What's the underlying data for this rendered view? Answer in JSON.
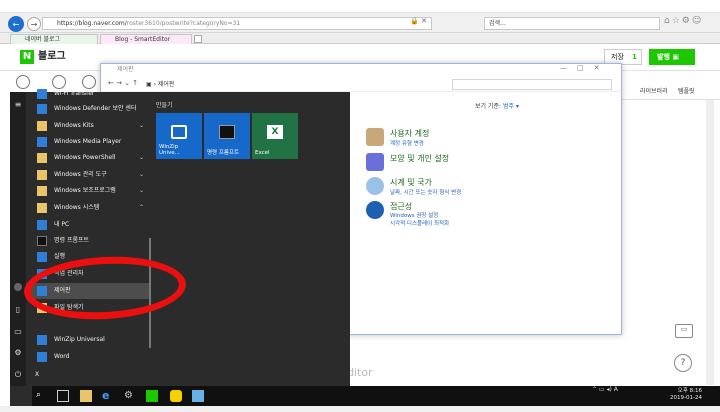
{
  "browser": {
    "url": "https://blog.naver.com/",
    "url_tail": "roster3610/postwrite?categoryNo=31",
    "search_text": "검색...",
    "tabs": [
      {
        "label": "네이버 블로그"
      },
      {
        "label": "Blog - SmartEditor"
      }
    ]
  },
  "naver": {
    "blog_title": "블로그",
    "save_label": "저장",
    "save_count": "1",
    "publish_label": "발행",
    "toolbar_right": [
      "라이브러리",
      "템플릿"
    ],
    "editor_watermark": "Editor"
  },
  "control_panel": {
    "title": "제어판",
    "path": "제어판",
    "view_by_label": "보기 기준:",
    "view_by_value": "범주 ▾",
    "categories": [
      {
        "title": "사용자 계정",
        "links": [
          "계정 유형 변경"
        ]
      },
      {
        "title": "모양 및 개인 설정",
        "links": []
      },
      {
        "title": "시계 및 국가",
        "links": [
          "날짜, 시간 또는 숫자 형식 변경"
        ]
      },
      {
        "title": "접근성",
        "links": [
          "Windows 권장 설정",
          "시각적 디스플레이 최적화"
        ]
      }
    ]
  },
  "start_menu": {
    "apps": [
      {
        "label": "Wi-Fi Transfer",
        "icon": "blue",
        "chev": ""
      },
      {
        "label": "Windows Defender 보안 센터",
        "icon": "blue",
        "chev": ""
      },
      {
        "label": "Windows Kits",
        "icon": "folder",
        "chev": "⌄"
      },
      {
        "label": "Windows Media Player",
        "icon": "blue",
        "chev": ""
      },
      {
        "label": "Windows PowerShell",
        "icon": "folder",
        "chev": "⌄"
      },
      {
        "label": "Windows 관리 도구",
        "icon": "folder",
        "chev": "⌄"
      },
      {
        "label": "Windows 보조프로그램",
        "icon": "folder",
        "chev": "⌄"
      },
      {
        "label": "Windows 시스템",
        "icon": "folder",
        "chev": "⌃"
      },
      {
        "label": "내 PC",
        "icon": "blue",
        "chev": ""
      },
      {
        "label": "명령 프롬프트",
        "icon": "dark",
        "chev": ""
      },
      {
        "label": "실행",
        "icon": "blue",
        "chev": ""
      },
      {
        "label": "작업 관리자",
        "icon": "blue",
        "chev": ""
      },
      {
        "label": "제어판",
        "icon": "blue",
        "chev": ""
      },
      {
        "label": "파일 탐색기",
        "icon": "folder",
        "chev": ""
      },
      {
        "label": "",
        "icon": "",
        "chev": ""
      },
      {
        "label": "WinZip Universal",
        "icon": "blue",
        "chev": ""
      },
      {
        "label": "Word",
        "icon": "blue",
        "chev": ""
      },
      {
        "label": "X",
        "icon": "",
        "chev": ""
      }
    ],
    "tiles_title": "만들기",
    "tiles": [
      {
        "label": "WinZip Unive...",
        "color": "#1769c9"
      },
      {
        "label": "명령 프롬프트",
        "color": "#1769c9"
      },
      {
        "label": "Excel",
        "color": "#217346"
      }
    ]
  },
  "taskbar": {
    "ime": "A",
    "time": "오후 8:16",
    "date": "2019-01-24"
  },
  "colors": {
    "naver_green": "#1ec800",
    "annotation_red": "#ec0f0f",
    "start_bg": "#2b2b2b"
  }
}
